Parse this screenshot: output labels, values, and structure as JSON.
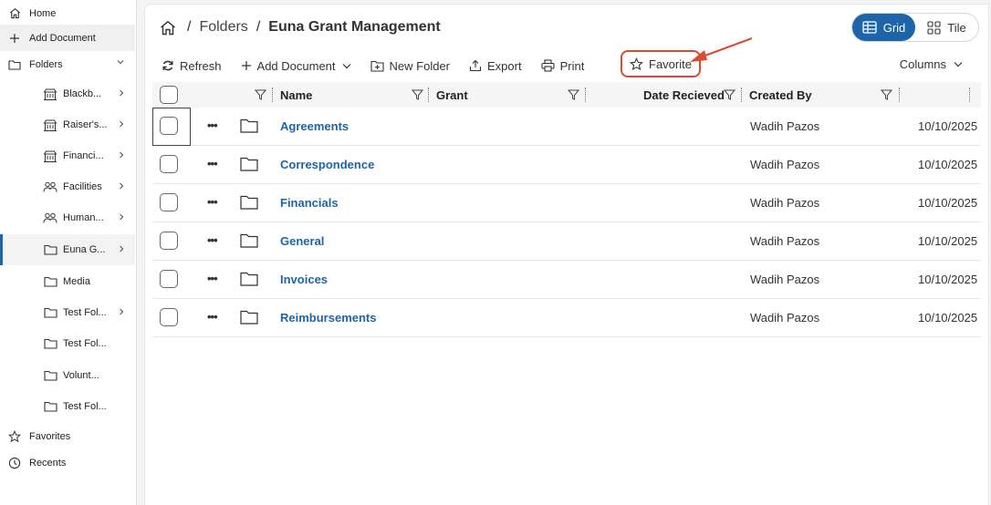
{
  "sidebar": {
    "top_items": [
      {
        "label": "Home",
        "icon": "home-icon"
      },
      {
        "label": "Add Document",
        "icon": "plus-icon"
      },
      {
        "label": "Folders",
        "icon": "folder-icon",
        "expanded": true
      }
    ],
    "sub_items": [
      {
        "label": "Blackb...",
        "icon": "building-icon",
        "has_children": true
      },
      {
        "label": "Raiser's...",
        "icon": "building-icon",
        "has_children": true
      },
      {
        "label": "Financi...",
        "icon": "building-icon",
        "has_children": true
      },
      {
        "label": "Facilities",
        "icon": "people-icon",
        "has_children": true
      },
      {
        "label": "Human...",
        "icon": "people-icon",
        "has_children": true
      },
      {
        "label": "Euna G...",
        "icon": "folder-icon",
        "has_children": true,
        "active": true
      },
      {
        "label": "Media",
        "icon": "folder-icon",
        "has_children": false
      },
      {
        "label": "Test Fol...",
        "icon": "folder-icon",
        "has_children": true
      },
      {
        "label": "Test Fol...",
        "icon": "folder-icon",
        "has_children": false
      },
      {
        "label": "Volunt...",
        "icon": "folder-icon",
        "has_children": false
      },
      {
        "label": "Test Fol...",
        "icon": "folder-icon",
        "has_children": false
      }
    ],
    "bottom_items": [
      {
        "label": "Favorites",
        "icon": "star-icon"
      },
      {
        "label": "Recents",
        "icon": "clock-icon"
      }
    ]
  },
  "breadcrumb": {
    "segments": [
      "Folders",
      "Euna Grant Management"
    ],
    "separator": "/"
  },
  "view_toggle": {
    "grid_label": "Grid",
    "tile_label": "Tile",
    "selected": "Grid"
  },
  "toolbar": {
    "refresh": "Refresh",
    "add_document": "Add Document",
    "new_folder": "New Folder",
    "export": "Export",
    "print": "Print",
    "favorite": "Favorite",
    "columns": "Columns"
  },
  "grid": {
    "columns": [
      "Name",
      "Grant",
      "Date Recieved",
      "Created By"
    ],
    "rows": [
      {
        "name": "Agreements",
        "created_by": "Wadih Pazos",
        "date": "10/10/2025"
      },
      {
        "name": "Correspondence",
        "created_by": "Wadih Pazos",
        "date": "10/10/2025"
      },
      {
        "name": "Financials",
        "created_by": "Wadih Pazos",
        "date": "10/10/2025"
      },
      {
        "name": "General",
        "created_by": "Wadih Pazos",
        "date": "10/10/2025"
      },
      {
        "name": "Invoices",
        "created_by": "Wadih Pazos",
        "date": "10/10/2025"
      },
      {
        "name": "Reimbursements",
        "created_by": "Wadih Pazos",
        "date": "10/10/2025"
      }
    ]
  },
  "colors": {
    "accent": "#1e64a8",
    "highlight": "#dc4a33"
  }
}
